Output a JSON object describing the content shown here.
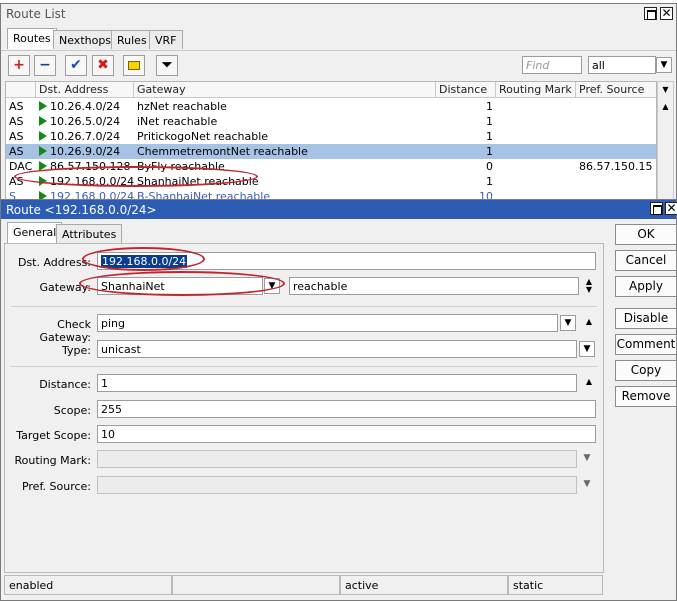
{
  "route_list": {
    "title": "Route List",
    "tabs": [
      "Routes",
      "Nexthops",
      "Rules",
      "VRF"
    ],
    "find_placeholder": "Find",
    "filter_value": "all",
    "columns": [
      "",
      "Dst. Address",
      "Gateway",
      "Distance",
      "Routing Mark",
      "Pref. Source"
    ],
    "rows": [
      {
        "flags": "AS",
        "dst": "10.26.4.0/24",
        "gateway": "hzNet reachable",
        "distance": "1",
        "mark": "",
        "pref": ""
      },
      {
        "flags": "AS",
        "dst": "10.26.5.0/24",
        "gateway": "iNet reachable",
        "distance": "1",
        "mark": "",
        "pref": ""
      },
      {
        "flags": "AS",
        "dst": "10.26.7.0/24",
        "gateway": "PritickogoNet reachable",
        "distance": "1",
        "mark": "",
        "pref": ""
      },
      {
        "flags": "AS",
        "dst": "10.26.9.0/24",
        "gateway": "ChemmetremontNet reachable",
        "distance": "1",
        "mark": "",
        "pref": ""
      },
      {
        "flags": "DAC",
        "dst": "86.57.150.128",
        "gateway": "ByFly reachable",
        "distance": "0",
        "mark": "",
        "pref": "86.57.150.15"
      },
      {
        "flags": "AS",
        "dst": "192.168.0.0/24",
        "gateway": "ShanhaiNet reachable",
        "distance": "1",
        "mark": "",
        "pref": ""
      },
      {
        "flags": "S",
        "dst": "192.168.0.0/24",
        "gateway": "B-ShanhaiNet reachable",
        "distance": "10",
        "mark": "",
        "pref": ""
      }
    ]
  },
  "route_dialog": {
    "title": "Route <192.168.0.0/24>",
    "tabs": [
      "General",
      "Attributes"
    ],
    "fields": {
      "dst_address": {
        "label": "Dst. Address:",
        "value": "192.168.0.0/24"
      },
      "gateway": {
        "label": "Gateway:",
        "value": "ShanhaiNet",
        "state": "reachable"
      },
      "check_gateway": {
        "label": "Check Gateway:",
        "value": "ping"
      },
      "type": {
        "label": "Type:",
        "value": "unicast"
      },
      "distance": {
        "label": "Distance:",
        "value": "1"
      },
      "scope": {
        "label": "Scope:",
        "value": "255"
      },
      "target_scope": {
        "label": "Target Scope:",
        "value": "10"
      },
      "routing_mark": {
        "label": "Routing Mark:",
        "value": ""
      },
      "pref_source": {
        "label": "Pref. Source:",
        "value": ""
      }
    },
    "buttons": [
      "OK",
      "Cancel",
      "Apply",
      "Disable",
      "Comment",
      "Copy",
      "Remove"
    ],
    "status": [
      "enabled",
      "",
      "active",
      "static"
    ]
  },
  "colors": {
    "selection": "#a6c3e6",
    "highlight": "#0a3c8c",
    "annotation": "#c0262f",
    "dialog_title": "#2d5cb5"
  }
}
